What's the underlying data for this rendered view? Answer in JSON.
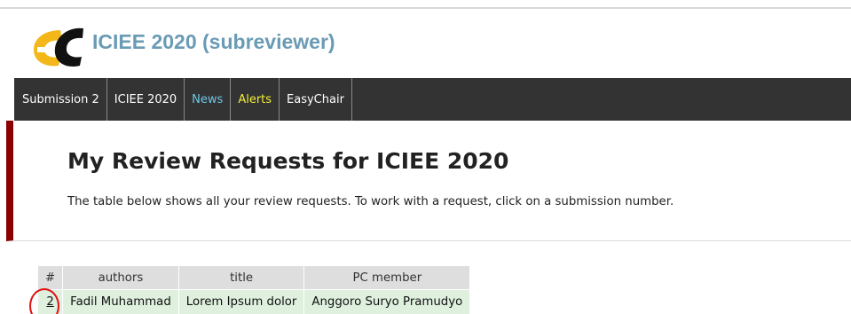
{
  "header": {
    "title": "ICIEE 2020 (subreviewer)",
    "logo_icon": "easychair-logo-icon",
    "colors": {
      "logo_yellow": "#f3b71a",
      "logo_black": "#111111",
      "title": "#6a9bb5"
    }
  },
  "navbar": {
    "items": [
      {
        "label": "Submission 2"
      },
      {
        "label": "ICIEE 2020"
      },
      {
        "label": "News",
        "color": "#6ec8e6"
      },
      {
        "label": "Alerts",
        "color": "#f2ee3a"
      },
      {
        "label": "EasyChair"
      }
    ]
  },
  "main": {
    "title": "My Review Requests for ICIEE 2020",
    "description": "The table below shows all your review requests. To work with a request, click on a submission number."
  },
  "table": {
    "headers": [
      "#",
      "authors",
      "title",
      "PC member"
    ],
    "rows": [
      {
        "number": "2",
        "authors": "Fadil Muhammad",
        "title": "Lorem Ipsum dolor",
        "pc_member": "Anggoro Suryo Pramudyo"
      }
    ]
  },
  "annotation": {
    "color": "#e01010"
  }
}
